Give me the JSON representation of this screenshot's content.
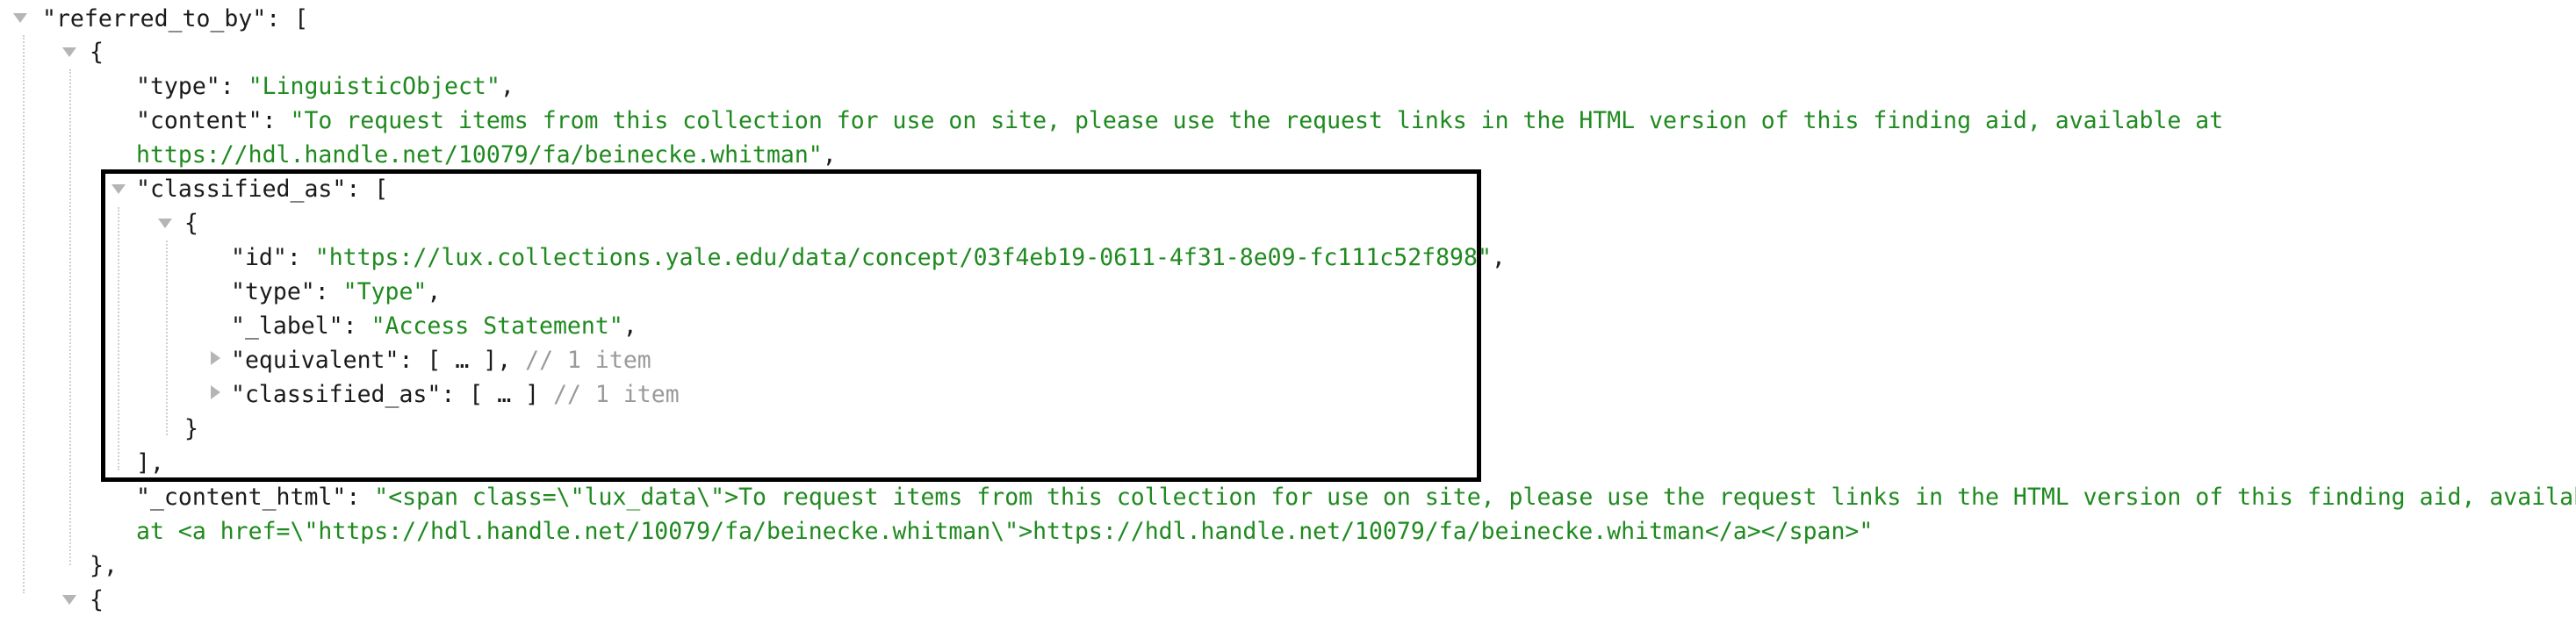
{
  "rows": {
    "r0": {
      "key": "\"referred_to_by\"",
      "sep": ": ",
      "open": "["
    },
    "r1": {
      "open": "{"
    },
    "r2": {
      "key": "\"type\"",
      "sep": ": ",
      "value": "\"LinguisticObject\"",
      "end": ","
    },
    "r3": {
      "key": "\"content\"",
      "sep": ": ",
      "value": "\"To request items from this collection for use on site, please use the request links in the HTML version of this finding aid, available at"
    },
    "r4": {
      "value": "https://hdl.handle.net/10079/fa/beinecke.whitman\"",
      "end": ","
    },
    "r5": {
      "key": "\"classified_as\"",
      "sep": ": ",
      "open": "["
    },
    "r6": {
      "open": "{"
    },
    "r7": {
      "key": "\"id\"",
      "sep": ": ",
      "value": "\"https://lux.collections.yale.edu/data/concept/03f4eb19-0611-4f31-8e09-fc111c52f898\"",
      "end": ","
    },
    "r8": {
      "key": "\"type\"",
      "sep": ": ",
      "value": "\"Type\"",
      "end": ","
    },
    "r9": {
      "key": "\"_label\"",
      "sep": ": ",
      "value": "\"Access Statement\"",
      "end": ","
    },
    "r10": {
      "key": "\"equivalent\"",
      "sep": ": ",
      "open": "[",
      "ellipsis": "…",
      "close": "]",
      "end": ",",
      "comment": "// 1 item"
    },
    "r11": {
      "key": "\"classified_as\"",
      "sep": ": ",
      "open": "[",
      "ellipsis": "…",
      "close": "]",
      "comment": "// 1 item"
    },
    "r12": {
      "close": "}"
    },
    "r13": {
      "close": "]",
      "end": ","
    },
    "r14": {
      "key": "\"_content_html\"",
      "sep": ": ",
      "value": "\"<span class=\\\"lux_data\\\">To request items from this collection for use on site, please use the request links in the HTML version of this finding aid, available"
    },
    "r15": {
      "value": "at <a href=\\\"https://hdl.handle.net/10079/fa/beinecke.whitman\\\">https://hdl.handle.net/10079/fa/beinecke.whitman</a></span>\""
    },
    "r16": {
      "close": "}",
      "end": ","
    },
    "r17": {
      "open": "{"
    }
  },
  "colors": {
    "key": "#1a1a1a",
    "string": "#1f8a1f",
    "comment": "#9a9a9a",
    "toggle": "#b5b5b5",
    "highlight_border": "#000000"
  },
  "icons": [
    "expanded-triangle-icon",
    "collapsed-triangle-icon"
  ]
}
